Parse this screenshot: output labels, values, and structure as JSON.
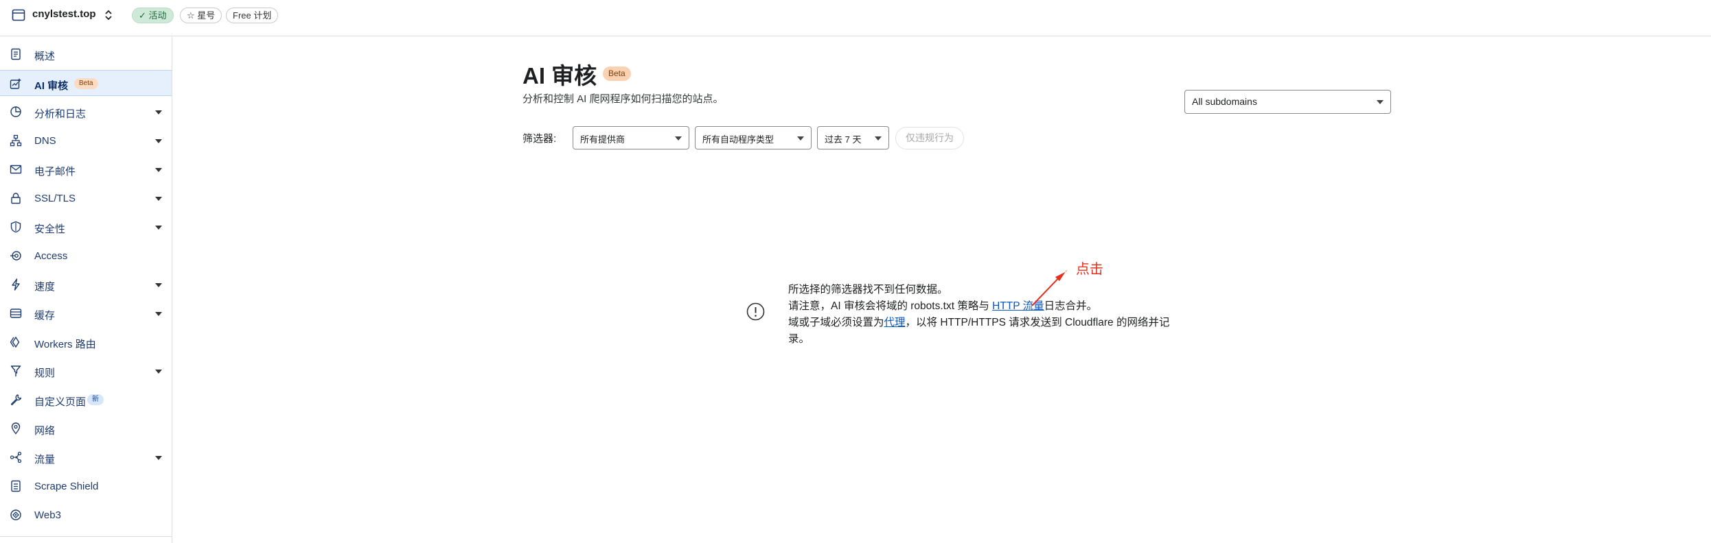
{
  "header": {
    "domain": "cnylstest.top",
    "status_badge": "活动",
    "star_badge": "星号",
    "plan_badge": "Free 计划"
  },
  "sidebar": {
    "items": [
      {
        "label": "概述",
        "icon": "document-icon"
      },
      {
        "label": "AI 审核",
        "icon": "ai-audit-icon",
        "tag": "Beta",
        "active": true
      },
      {
        "label": "分析和日志",
        "icon": "analytics-icon",
        "expandable": true
      },
      {
        "label": "DNS",
        "icon": "dns-icon",
        "expandable": true
      },
      {
        "label": "电子邮件",
        "icon": "email-icon",
        "expandable": true
      },
      {
        "label": "SSL/TLS",
        "icon": "lock-icon",
        "expandable": true
      },
      {
        "label": "安全性",
        "icon": "shield-icon",
        "expandable": true
      },
      {
        "label": "Access",
        "icon": "access-icon"
      },
      {
        "label": "速度",
        "icon": "lightning-icon",
        "expandable": true
      },
      {
        "label": "缓存",
        "icon": "cache-icon",
        "expandable": true
      },
      {
        "label": "Workers 路由",
        "icon": "workers-icon"
      },
      {
        "label": "规则",
        "icon": "rules-icon",
        "expandable": true
      },
      {
        "label": "自定义页面",
        "icon": "wrench-icon",
        "tag": "新"
      },
      {
        "label": "网络",
        "icon": "location-icon"
      },
      {
        "label": "流量",
        "icon": "traffic-icon",
        "expandable": true
      },
      {
        "label": "Scrape Shield",
        "icon": "scrape-shield-icon"
      },
      {
        "label": "Web3",
        "icon": "web3-icon"
      }
    ]
  },
  "main": {
    "title": "AI 审核",
    "title_badge": "Beta",
    "subtitle": "分析和控制 AI 爬网程序如何扫描您的站点。",
    "subdomain_select": "All subdomains",
    "filter_label": "筛选器:",
    "filters": {
      "provider": "所有提供商",
      "bot_type": "所有自动程序类型",
      "range": "过去 7 天",
      "violations_button": "仅违规行为"
    },
    "notice": {
      "line1": "所选择的筛选器找不到任何数据。",
      "line2_pre": "请注意，AI 审核会将域的 robots.txt 策略与 ",
      "line2_link": "HTTP 流量",
      "line2_post": "日志合并。",
      "line3_pre": "域或子域必须设置为",
      "line3_link": "代理",
      "line3_post": "，以将 HTTP/HTTPS 请求发送到 Cloudflare 的网络并记录。"
    },
    "annotation": "点击"
  },
  "colors": {
    "accent_link": "#0a56c2",
    "active_bg": "#e6f0fc",
    "beta_badge": "#fbd2b1",
    "annotation_red": "#e0321e"
  }
}
